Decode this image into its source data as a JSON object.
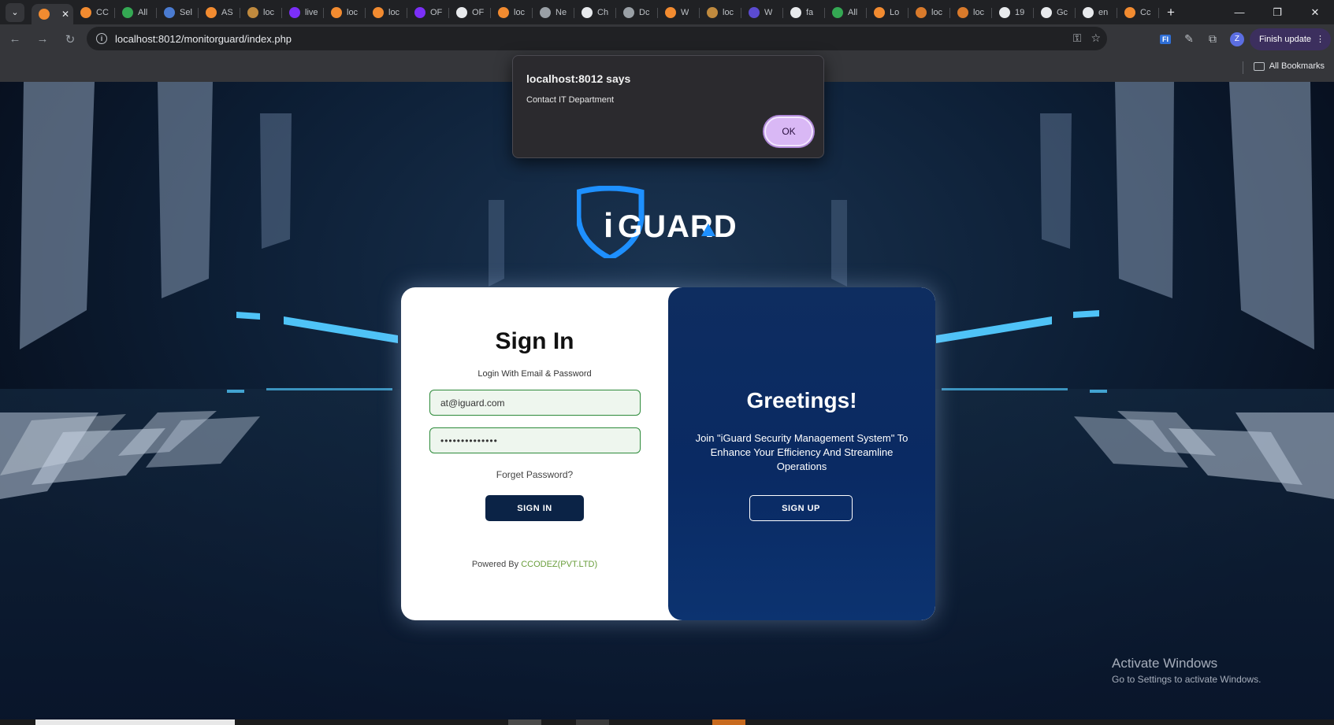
{
  "browser": {
    "tabs": [
      {
        "label": "",
        "favicon_color": "#f28b30",
        "active": true
      },
      {
        "label": "CC",
        "favicon_color": "#f28b30"
      },
      {
        "label": "All",
        "favicon_color": "#34a853"
      },
      {
        "label": "Sel",
        "favicon_color": "#4a7bd1"
      },
      {
        "label": "AS",
        "favicon_color": "#f28b30"
      },
      {
        "label": "loc",
        "favicon_color": "#c08a3e"
      },
      {
        "label": "live",
        "favicon_color": "#7b2ff7"
      },
      {
        "label": "loc",
        "favicon_color": "#f28b30"
      },
      {
        "label": "loc",
        "favicon_color": "#f28b30"
      },
      {
        "label": "OF",
        "favicon_color": "#7b2ff7"
      },
      {
        "label": "OF",
        "favicon_color": "#e8eaed"
      },
      {
        "label": "loc",
        "favicon_color": "#f28b30"
      },
      {
        "label": "Ne",
        "favicon_color": "#9aa0a6"
      },
      {
        "label": "Ch",
        "favicon_color": "#e8eaed"
      },
      {
        "label": "Dc",
        "favicon_color": "#9aa0a6"
      },
      {
        "label": "W",
        "favicon_color": "#f28b30"
      },
      {
        "label": "loc",
        "favicon_color": "#c08a3e"
      },
      {
        "label": "W",
        "favicon_color": "#5b4bd1"
      },
      {
        "label": "fa",
        "favicon_color": "#e8eaed"
      },
      {
        "label": "All",
        "favicon_color": "#34a853"
      },
      {
        "label": "Lo",
        "favicon_color": "#f28b30"
      },
      {
        "label": "loc",
        "favicon_color": "#d97a2b"
      },
      {
        "label": "loc",
        "favicon_color": "#d97a2b"
      },
      {
        "label": "19",
        "favicon_color": "#e8eaed"
      },
      {
        "label": "Gc",
        "favicon_color": "#e8eaed"
      },
      {
        "label": "en",
        "favicon_color": "#e8eaed"
      },
      {
        "label": "Cc",
        "favicon_color": "#f28b30"
      }
    ],
    "url": "localhost:8012/monitorguard/index.php",
    "finish_update_label": "Finish update",
    "profile_initial": "Z",
    "all_bookmarks_label": "All Bookmarks"
  },
  "dialog": {
    "title": "localhost:8012 says",
    "message": "Contact IT Department",
    "ok_label": "OK"
  },
  "logo": {
    "text_i": "i",
    "text_rest": "GUARD"
  },
  "signin": {
    "title": "Sign In",
    "subtitle": "Login With Email & Password",
    "email_value": "at@iguard.com",
    "password_value": "••••••••••••••",
    "forget_label": "Forget Password?",
    "button_label": "SIGN IN",
    "powered_prefix": "Powered By ",
    "powered_brand": "CCODEZ(PVT.LTD)"
  },
  "greetings": {
    "title": "Greetings!",
    "text": "Join \"iGuard Security Management System\" To Enhance Your Efficiency And Streamline Operations",
    "button_label": "SIGN UP"
  },
  "watermark": {
    "line1": "Activate Windows",
    "line2": "Go to Settings to activate Windows."
  },
  "colors": {
    "brand_navy": "#0b2346",
    "panel_blue": "#0a2a63",
    "field_border": "#2d8a3a",
    "accent_green": "#6a9e3c",
    "logo_blue": "#1e90ff",
    "dialog_ok": "#d9b8f5"
  }
}
